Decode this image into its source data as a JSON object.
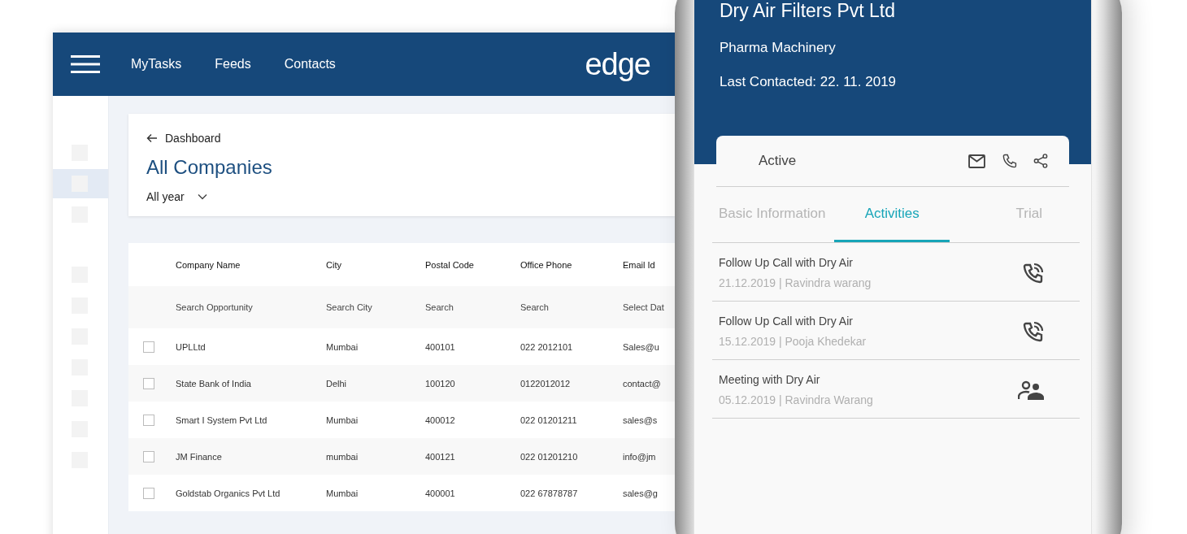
{
  "header": {
    "nav": [
      {
        "label": "MyTasks"
      },
      {
        "label": "Feeds"
      },
      {
        "label": "Contacts"
      }
    ],
    "logo": "edge"
  },
  "sidebar": {
    "groups": [
      {
        "items": [
          {
            "selected": false
          },
          {
            "selected": true
          },
          {
            "selected": false
          }
        ]
      },
      {
        "items": [
          {
            "selected": false
          },
          {
            "selected": false
          },
          {
            "selected": false
          },
          {
            "selected": false
          },
          {
            "selected": false
          },
          {
            "selected": false
          },
          {
            "selected": false
          }
        ]
      }
    ]
  },
  "page": {
    "back_link": "Dashboard",
    "title": "All Companies",
    "period_filter": "All year"
  },
  "table": {
    "columns": [
      "Company Name",
      "City",
      "Postal Code",
      "Office Phone",
      "Email Id"
    ],
    "filters": [
      {
        "placeholder": "Search Opportunity"
      },
      {
        "placeholder": "Search City"
      },
      {
        "placeholder": "Search"
      },
      {
        "placeholder": "Search"
      },
      {
        "placeholder": "Select Dat"
      }
    ],
    "rows": [
      {
        "checked": false,
        "cells": [
          "UPLLtd",
          "Mumbai",
          "400101",
          "022 2012101",
          "Sales@u"
        ]
      },
      {
        "checked": false,
        "cells": [
          "State Bank of India",
          "Delhi",
          "100120",
          "0122012012",
          "contact@"
        ]
      },
      {
        "checked": false,
        "cells": [
          "Smart I System Pvt Ltd",
          "Mumbai",
          "400012",
          "022 01201211",
          "sales@s"
        ]
      },
      {
        "checked": false,
        "cells": [
          "JM Finance",
          "mumbai",
          "400121",
          "022 01201210",
          "info@jm"
        ]
      },
      {
        "checked": false,
        "cells": [
          "Goldstab Organics Pvt Ltd",
          "Mumbai",
          "400001",
          "022 67878787",
          "sales@g"
        ]
      }
    ]
  },
  "phone": {
    "company": "Dry Air Filters Pvt Ltd",
    "industry": "Pharma Machinery",
    "last_contacted": "Last Contacted: 22. 11. 2019",
    "status": "Active",
    "tabs": [
      {
        "label": "Basic Information",
        "selected": false
      },
      {
        "label": "Activities",
        "selected": true
      },
      {
        "label": "Trial",
        "selected": false
      }
    ],
    "activities": [
      {
        "title": "Follow Up Call with Dry Air",
        "meta": "21.12.2019 | Ravindra warang",
        "kind": "call"
      },
      {
        "title": "Follow Up Call with Dry Air",
        "meta": "15.12.2019 | Pooja Khedekar",
        "kind": "call"
      },
      {
        "title": "Meeting with Dry Air",
        "meta": "05.12.2019 | Ravindra Warang",
        "kind": "meeting"
      }
    ]
  }
}
